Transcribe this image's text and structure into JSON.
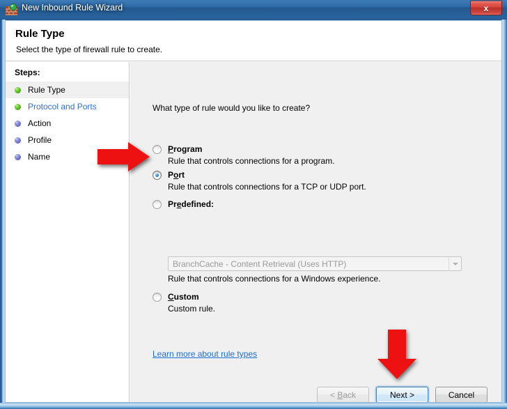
{
  "window": {
    "title": "New Inbound Rule Wizard",
    "icon": "firewall-icon",
    "close_label": "x"
  },
  "header": {
    "title": "Rule Type",
    "subtitle": "Select the type of firewall rule to create."
  },
  "sidebar": {
    "heading": "Steps:",
    "items": [
      {
        "label": "Rule Type",
        "state": "current",
        "bullet": "green"
      },
      {
        "label": "Protocol and Ports",
        "state": "link",
        "bullet": "green"
      },
      {
        "label": "Action",
        "state": "pending",
        "bullet": "blue"
      },
      {
        "label": "Profile",
        "state": "pending",
        "bullet": "blue"
      },
      {
        "label": "Name",
        "state": "pending",
        "bullet": "blue"
      }
    ]
  },
  "main": {
    "question": "What type of rule would you like to create?",
    "options": [
      {
        "id": "program",
        "title": "Program",
        "accel_index": 0,
        "description": "Rule that controls connections for a program.",
        "selected": false
      },
      {
        "id": "port",
        "title": "Port",
        "accel_index": 1,
        "description": "Rule that controls connections for a TCP or UDP port.",
        "selected": true
      },
      {
        "id": "predefined",
        "title": "Predefined:",
        "accel_index": 2,
        "description": "Rule that controls connections for a Windows experience.",
        "selected": false
      },
      {
        "id": "custom",
        "title": "Custom",
        "accel_index": 0,
        "description": "Custom rule.",
        "selected": false
      }
    ],
    "predefined_combo": {
      "value": "BranchCache - Content Retrieval (Uses HTTP)",
      "enabled": false,
      "arrow_icon": "chevron-down-icon"
    },
    "learn_more_link": "Learn more about rule types"
  },
  "footer": {
    "back_label": "< Back",
    "next_label": "Next >",
    "cancel_label": "Cancel",
    "back_enabled": false,
    "next_default": true
  },
  "annotations": {
    "arrow_color": "#ee1111",
    "arrow_targets": [
      "port-radio",
      "next-button"
    ]
  }
}
